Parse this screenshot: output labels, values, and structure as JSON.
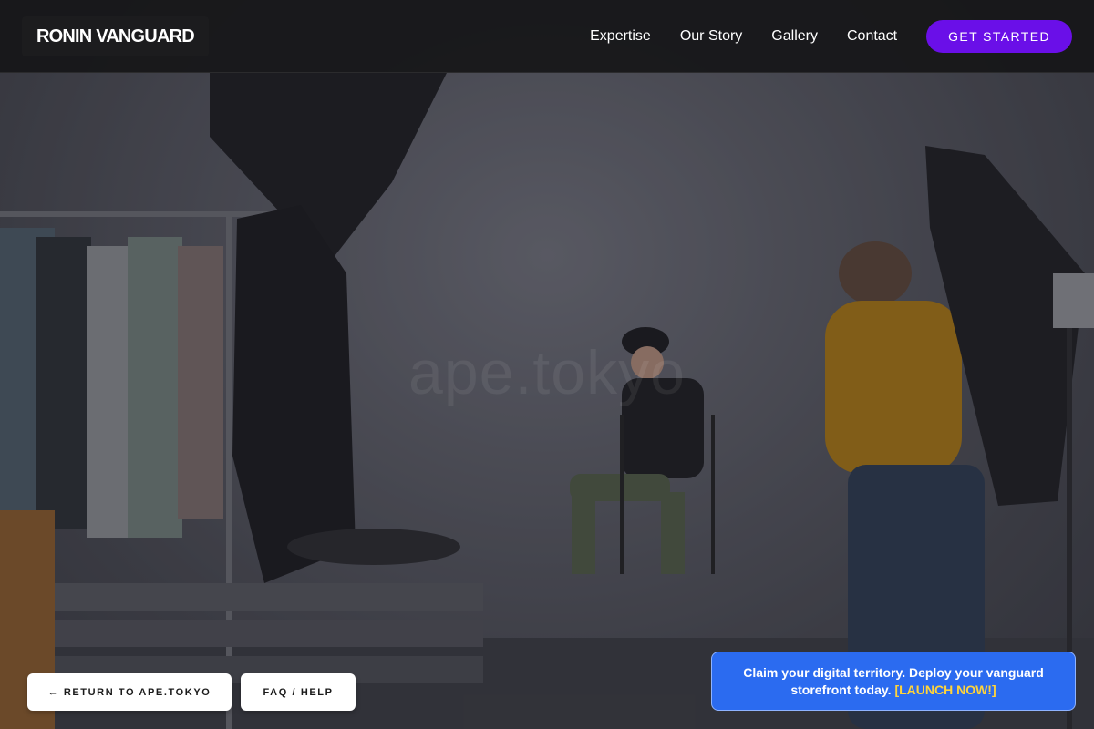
{
  "header": {
    "logo": "RONIN VANGUARD",
    "nav": [
      {
        "label": "Expertise"
      },
      {
        "label": "Our Story"
      },
      {
        "label": "Gallery"
      },
      {
        "label": "Contact"
      }
    ],
    "cta_label": "GET STARTED"
  },
  "hero": {
    "watermark": "ape.tokyo"
  },
  "footer_buttons": {
    "return_label": "← RETURN TO APE.TOKYO",
    "faq_label": "FAQ / HELP"
  },
  "promo": {
    "text": "Claim your digital territory. Deploy your vanguard storefront today.",
    "link_label": "[LAUNCH NOW!]"
  },
  "colors": {
    "accent_purple": "#6a0fe8",
    "promo_blue": "#2b6bf0",
    "promo_link_yellow": "#ffd43b"
  }
}
